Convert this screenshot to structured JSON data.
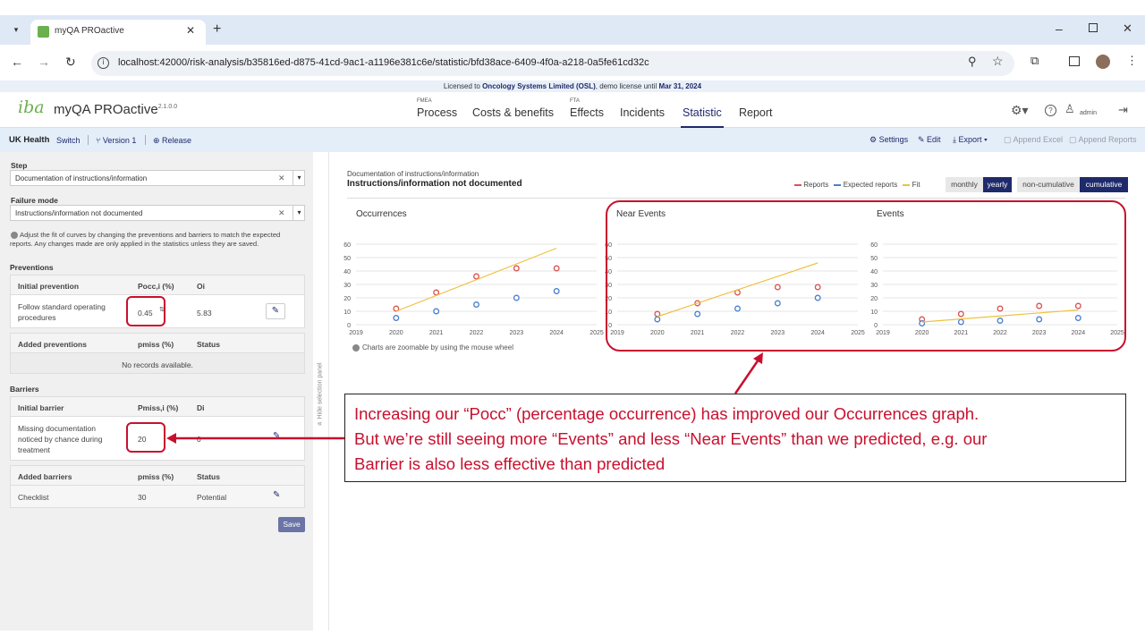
{
  "browser": {
    "tab_title": "myQA PROactive",
    "url": "localhost:42000/risk-analysis/b35816ed-d875-41cd-9ac1-a1196e381c6e/statistic/bfd38ace-6409-4f0a-a218-0a5fe61cd32c"
  },
  "license": {
    "prefix": "Licensed to",
    "org": "Oncology Systems Limited (OSL)",
    "mid": ", demo license until",
    "date": "Mar 31, 2024"
  },
  "app": {
    "logo": "iba",
    "name": "myQA PROactive",
    "version": "2.1.0.0",
    "nav": [
      {
        "small": "FMEA",
        "label": "Process"
      },
      {
        "small": "",
        "label": "Costs & benefits"
      },
      {
        "small": "FTA",
        "label": "Effects"
      },
      {
        "small": "",
        "label": "Incidents"
      },
      {
        "small": "",
        "label": "Statistic"
      },
      {
        "small": "",
        "label": "Report"
      }
    ],
    "user": "admin"
  },
  "subbar": {
    "org": "UK Health",
    "switch": "Switch",
    "version": "Version 1",
    "release": "Release",
    "settings": "Settings",
    "edit": "Edit",
    "export": "Export",
    "append_excel": "Append Excel",
    "append_reports": "Append Reports"
  },
  "left": {
    "step_label": "Step",
    "step_value": "Documentation of instructions/information",
    "failure_label": "Failure mode",
    "failure_value": "Instructions/information not documented",
    "info": "Adjust the fit of curves by changing the preventions and barriers to match the expected reports. Any changes made are only applied in the statistics unless they are saved.",
    "preventions_title": "Preventions",
    "prev_headers": [
      "Initial prevention",
      "Pocc,i (%)",
      "Oi"
    ],
    "prev_row": {
      "name": "Follow standard operating procedures",
      "pocc": "0.45",
      "oi": "5.83"
    },
    "added_prev_headers": [
      "Added preventions",
      "pmiss (%)",
      "Status"
    ],
    "no_records": "No records available.",
    "barriers_title": "Barriers",
    "barrier_headers": [
      "Initial barrier",
      "Pmiss,i (%)",
      "Di"
    ],
    "barrier_row": {
      "name": "Missing documentation noticed by chance during treatment",
      "pmiss": "20",
      "di": "0"
    },
    "added_barrier_headers": [
      "Added barriers",
      "pmiss (%)",
      "Status"
    ],
    "added_barrier_row": {
      "name": "Checklist",
      "pmiss": "30",
      "status": "Potential"
    },
    "save": "Save",
    "hide_panel": "Hide selection panel"
  },
  "main": {
    "step": "Documentation of instructions/information",
    "failure": "Instructions/information not documented",
    "legend": [
      "Reports",
      "Expected reports",
      "Fit"
    ],
    "toggle1": [
      "monthly",
      "yearly"
    ],
    "toggle2": [
      "non-cumulative",
      "cumulative"
    ],
    "zoom_note": "Charts are zoomable by using the mouse wheel"
  },
  "colors": {
    "reports": "#d9534f",
    "expected": "#4a7fd0",
    "fit": "#f0c040",
    "navy": "#1f2a6b",
    "annotation": "#c8102e"
  },
  "annotation": {
    "line1": "Increasing our “Pocc” (percentage occurrence) has improved our Occurrences graph.",
    "line2": "But we’re still seeing more “Events” and less “Near Events” than we predicted, e.g. our",
    "line3": "Barrier is also less effective than predicted"
  },
  "chart_data": [
    {
      "type": "scatter",
      "title": "Occurrences",
      "x_ticks": [
        "2019",
        "2020",
        "2021",
        "2022",
        "2023",
        "2024",
        "2025"
      ],
      "y_ticks": [
        "0",
        "10",
        "20",
        "30",
        "40",
        "50",
        "60"
      ],
      "ylim": [
        0,
        60
      ],
      "xlim": [
        2019,
        2025
      ],
      "series": [
        {
          "name": "Reports",
          "x": [
            2020,
            2021,
            2022,
            2023,
            2024
          ],
          "y": [
            12,
            24,
            36,
            42,
            42
          ]
        },
        {
          "name": "Expected reports",
          "x": [
            2020,
            2021,
            2022,
            2023,
            2024
          ],
          "y": [
            5,
            10,
            15,
            20,
            25
          ]
        },
        {
          "name": "Fit",
          "x": [
            2020,
            2024
          ],
          "y": [
            10,
            57
          ]
        }
      ]
    },
    {
      "type": "scatter",
      "title": "Near Events",
      "x_ticks": [
        "2019",
        "2020",
        "2021",
        "2022",
        "2023",
        "2024",
        "2025"
      ],
      "y_ticks": [
        "0",
        "10",
        "20",
        "30",
        "40",
        "50",
        "60"
      ],
      "ylim": [
        0,
        60
      ],
      "xlim": [
        2019,
        2025
      ],
      "series": [
        {
          "name": "Reports",
          "x": [
            2020,
            2021,
            2022,
            2023,
            2024
          ],
          "y": [
            8,
            16,
            24,
            28,
            28
          ]
        },
        {
          "name": "Expected reports",
          "x": [
            2020,
            2021,
            2022,
            2023,
            2024
          ],
          "y": [
            4,
            8,
            12,
            16,
            20
          ]
        },
        {
          "name": "Fit",
          "x": [
            2020,
            2024
          ],
          "y": [
            6,
            46
          ]
        }
      ]
    },
    {
      "type": "scatter",
      "title": "Events",
      "x_ticks": [
        "2019",
        "2020",
        "2021",
        "2022",
        "2023",
        "2024",
        "2025"
      ],
      "y_ticks": [
        "0",
        "10",
        "20",
        "30",
        "40",
        "50",
        "60"
      ],
      "ylim": [
        0,
        60
      ],
      "xlim": [
        2019,
        2025
      ],
      "series": [
        {
          "name": "Reports",
          "x": [
            2020,
            2021,
            2022,
            2023,
            2024
          ],
          "y": [
            4,
            8,
            12,
            14,
            14
          ]
        },
        {
          "name": "Expected reports",
          "x": [
            2020,
            2021,
            2022,
            2023,
            2024
          ],
          "y": [
            1,
            2,
            3,
            4,
            5
          ]
        },
        {
          "name": "Fit",
          "x": [
            2020,
            2024
          ],
          "y": [
            2,
            11
          ]
        }
      ]
    }
  ]
}
